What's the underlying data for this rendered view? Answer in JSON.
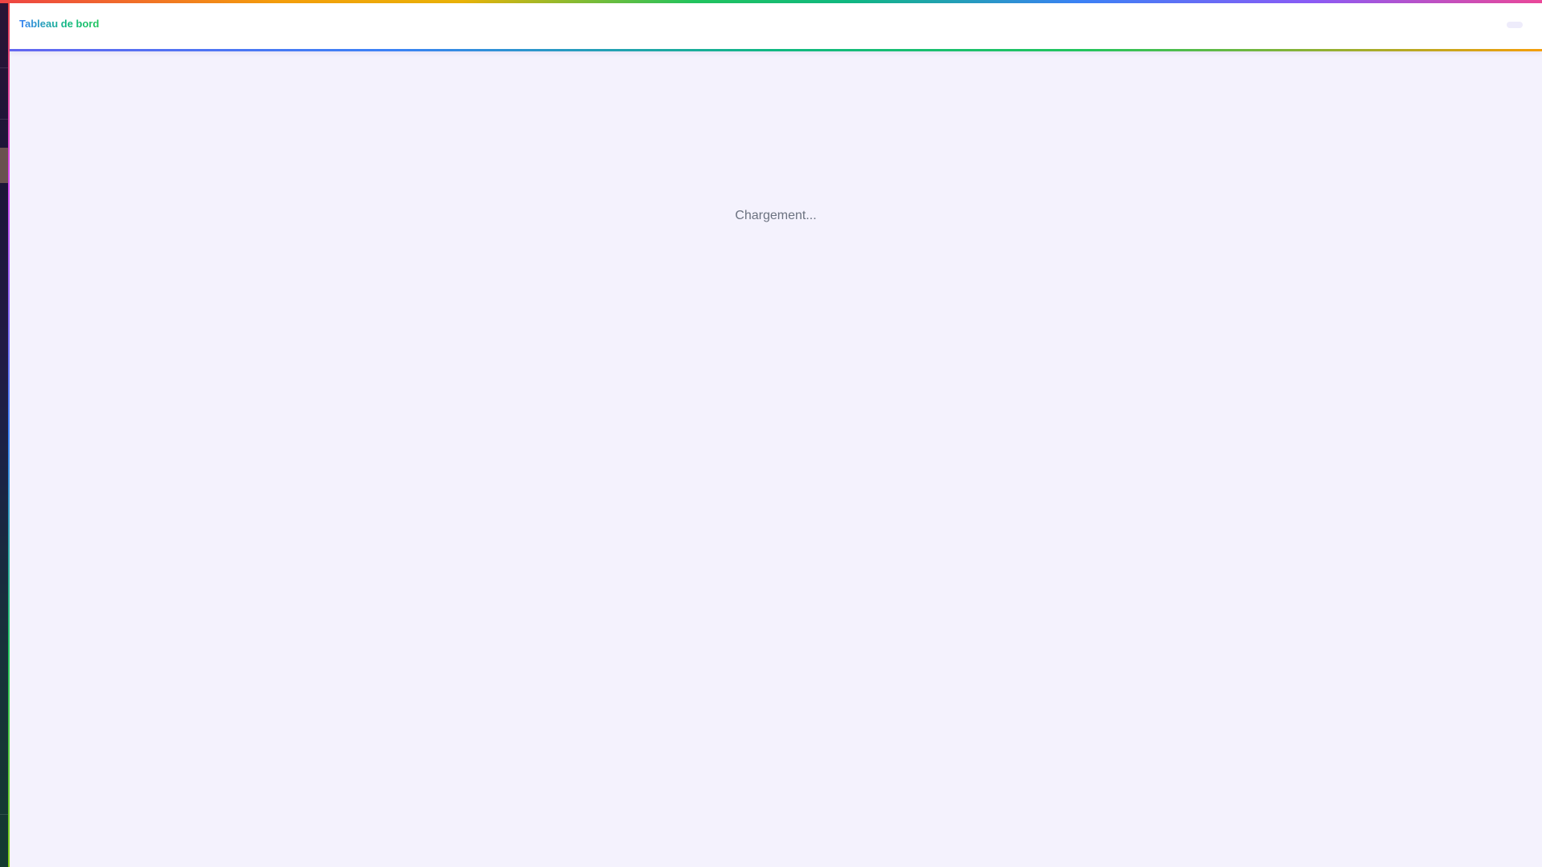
{
  "header": {
    "title": "Tableau de bord"
  },
  "main": {
    "loading_text": "Chargement..."
  },
  "colors": {
    "page_background": "#f4f2fd",
    "header_background": "#ffffff",
    "sidebar_background": "#1c1538",
    "loading_text": "#6b7280"
  }
}
